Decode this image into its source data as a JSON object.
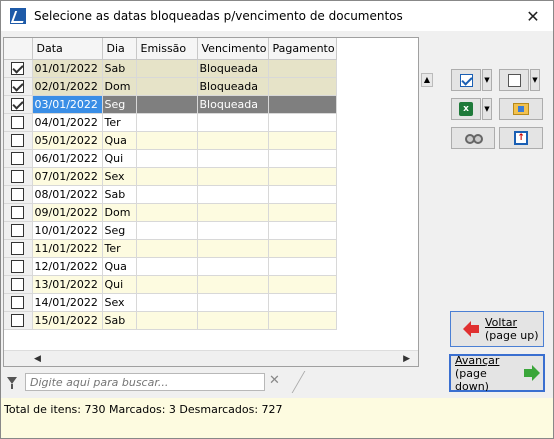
{
  "window": {
    "title": "Selecione as datas bloqueadas p/vencimento de documentos",
    "close_glyph": "✕"
  },
  "grid": {
    "columns": [
      "",
      "Data",
      "Dia",
      "Emissão",
      "Vencimento",
      "Pagamento"
    ],
    "rows": [
      {
        "checked": true,
        "data": "01/01/2022",
        "dia": "Sab",
        "emissao": "",
        "vencimento": "Bloqueada",
        "pagamento": ""
      },
      {
        "checked": true,
        "data": "02/01/2022",
        "dia": "Dom",
        "emissao": "",
        "vencimento": "Bloqueada",
        "pagamento": ""
      },
      {
        "checked": true,
        "data": "03/01/2022",
        "dia": "Seg",
        "emissao": "",
        "vencimento": "Bloqueada",
        "pagamento": ""
      },
      {
        "checked": false,
        "data": "04/01/2022",
        "dia": "Ter",
        "emissao": "",
        "vencimento": "",
        "pagamento": ""
      },
      {
        "checked": false,
        "data": "05/01/2022",
        "dia": "Qua",
        "emissao": "",
        "vencimento": "",
        "pagamento": ""
      },
      {
        "checked": false,
        "data": "06/01/2022",
        "dia": "Qui",
        "emissao": "",
        "vencimento": "",
        "pagamento": ""
      },
      {
        "checked": false,
        "data": "07/01/2022",
        "dia": "Sex",
        "emissao": "",
        "vencimento": "",
        "pagamento": ""
      },
      {
        "checked": false,
        "data": "08/01/2022",
        "dia": "Sab",
        "emissao": "",
        "vencimento": "",
        "pagamento": ""
      },
      {
        "checked": false,
        "data": "09/01/2022",
        "dia": "Dom",
        "emissao": "",
        "vencimento": "",
        "pagamento": ""
      },
      {
        "checked": false,
        "data": "10/01/2022",
        "dia": "Seg",
        "emissao": "",
        "vencimento": "",
        "pagamento": ""
      },
      {
        "checked": false,
        "data": "11/01/2022",
        "dia": "Ter",
        "emissao": "",
        "vencimento": "",
        "pagamento": ""
      },
      {
        "checked": false,
        "data": "12/01/2022",
        "dia": "Qua",
        "emissao": "",
        "vencimento": "",
        "pagamento": ""
      },
      {
        "checked": false,
        "data": "13/01/2022",
        "dia": "Qui",
        "emissao": "",
        "vencimento": "",
        "pagamento": ""
      },
      {
        "checked": false,
        "data": "14/01/2022",
        "dia": "Sex",
        "emissao": "",
        "vencimento": "",
        "pagamento": ""
      },
      {
        "checked": false,
        "data": "15/01/2022",
        "dia": "Sab",
        "emissao": "",
        "vencimento": "",
        "pagamento": ""
      }
    ],
    "selected_row": 2
  },
  "toolbar": {
    "check_all_icon": "checkbox-checked-icon",
    "uncheck_all_icon": "checkbox-empty-icon",
    "excel_icon": "excel-icon",
    "export_icon": "folder-export-icon",
    "search_icon": "binoculars-icon",
    "sort_icon": "sort-icon"
  },
  "nav": {
    "back_line1": "Voltar",
    "back_line2": "(page up)",
    "forward_line1": "Avançar",
    "forward_line2": "(page down)"
  },
  "search": {
    "placeholder": "Digite aqui para buscar...",
    "clear_glyph": "✕"
  },
  "status": {
    "text": "Total de itens: 730 Marcados: 3 Desmarcados: 727"
  },
  "colors": {
    "odd_row": "#fdfbe0",
    "blocked_row": "#e6e3c8",
    "selected_row": "#7f7f7f",
    "selected_cell": "#3a8ee6"
  }
}
